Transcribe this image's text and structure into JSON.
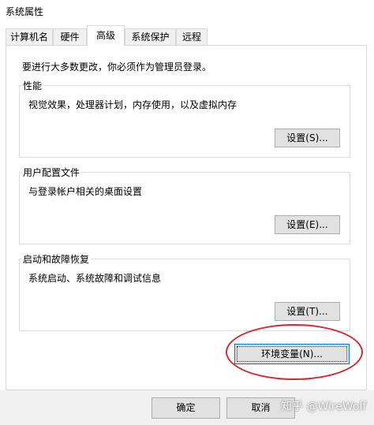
{
  "window": {
    "title": "系统属性"
  },
  "tabs": [
    {
      "label": "计算机名"
    },
    {
      "label": "硬件"
    },
    {
      "label": "高级",
      "active": true
    },
    {
      "label": "系统保护"
    },
    {
      "label": "远程"
    }
  ],
  "admin_note": "要进行大多数更改，你必须作为管理员登录。",
  "groups": {
    "performance": {
      "title": "性能",
      "desc": "视觉效果，处理器计划，内存使用，以及虚拟内存",
      "button": "设置(S)..."
    },
    "user_profiles": {
      "title": "用户配置文件",
      "desc": "与登录帐户相关的桌面设置",
      "button": "设置(E)..."
    },
    "startup_recovery": {
      "title": "启动和故障恢复",
      "desc": "系统启动、系统故障和调试信息",
      "button": "设置(T)..."
    }
  },
  "env_button": "环境变量(N)...",
  "footer": {
    "ok": "确定",
    "cancel": "取消"
  },
  "watermark": "知乎 @WireWolf",
  "colors": {
    "highlight": "#d9262e",
    "focus_border": "#0078d7"
  }
}
